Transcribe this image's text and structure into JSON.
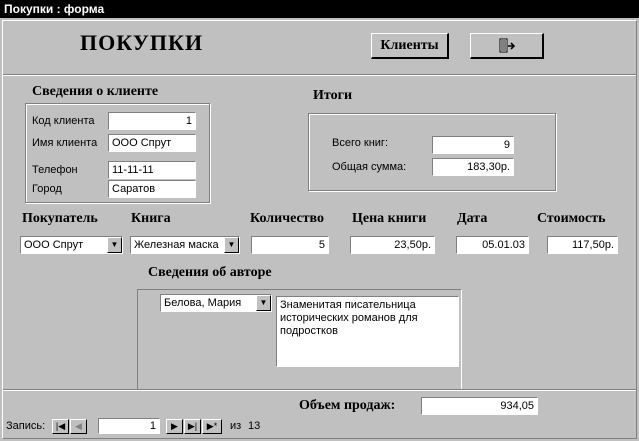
{
  "window": {
    "title": "Покупки : форма"
  },
  "header": {
    "title": "ПОКУПКИ",
    "clients_button": "Клиенты"
  },
  "client": {
    "section_title": "Сведения о клиенте",
    "code_label": "Код клиента",
    "code_value": "1",
    "name_label": "Имя клиента",
    "name_value": "ООО Спрут",
    "phone_label": "Телефон",
    "phone_value": "11-11-11",
    "city_label": "Город",
    "city_value": "Саратов"
  },
  "totals": {
    "section_title": "Итоги",
    "books_label": "Всего книг:",
    "books_value": "9",
    "sum_label": "Общая сумма:",
    "sum_value": "183,30р."
  },
  "purchase": {
    "buyer_label": "Покупатель",
    "buyer_value": "ООО Спрут",
    "book_label": "Книга",
    "book_value": "Железная маска",
    "qty_label": "Количество",
    "qty_value": "5",
    "price_label": "Цена книги",
    "price_value": "23,50р.",
    "date_label": "Дата",
    "date_value": "05.01.03",
    "cost_label": "Стоимость",
    "cost_value": "117,50р."
  },
  "author": {
    "section_title": "Сведения об авторе",
    "name_value": "Белова,  Мария",
    "description": "Знаменитая писательница исторических романов для подростков"
  },
  "sales": {
    "label": "Объем продаж:",
    "value": "934,05"
  },
  "navigator": {
    "record_label": "Запись:",
    "current": "1",
    "of_label": "из",
    "total": "13"
  }
}
